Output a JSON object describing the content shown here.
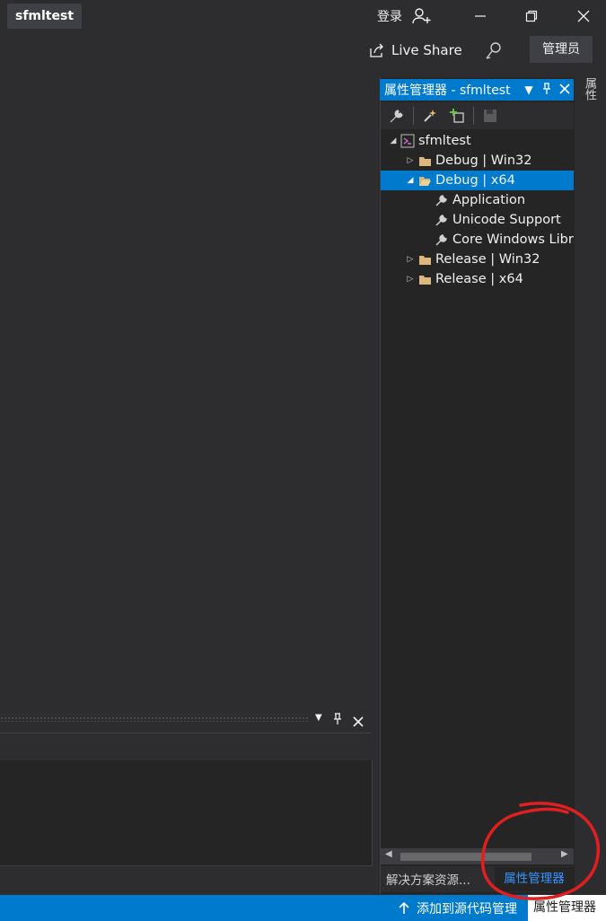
{
  "titlebar": {
    "project": "sfmltest",
    "login": "登录",
    "icons": [
      "user-add-icon",
      "minimize-icon",
      "restore-icon",
      "close-icon"
    ]
  },
  "toolbar2": {
    "live_share": "Live Share",
    "admin": "管理员"
  },
  "vertical_tab": "属性",
  "panel": {
    "title": "属性管理器 - sfmltest",
    "tree": [
      {
        "label": "sfmltest",
        "icon": "project-icon",
        "expanded": true,
        "level": 0
      },
      {
        "label": "Debug | Win32",
        "icon": "folder-icon",
        "expanded": false,
        "level": 1
      },
      {
        "label": "Debug | x64",
        "icon": "folder-open-icon",
        "expanded": true,
        "level": 1,
        "selected": true
      },
      {
        "label": "Application",
        "icon": "wrench-icon",
        "level": 2
      },
      {
        "label": "Unicode Support",
        "icon": "wrench-icon",
        "level": 2
      },
      {
        "label": "Core Windows Libraries",
        "icon": "wrench-icon",
        "level": 2
      },
      {
        "label": "Release | Win32",
        "icon": "folder-icon",
        "expanded": false,
        "level": 1
      },
      {
        "label": "Release | x64",
        "icon": "folder-icon",
        "expanded": false,
        "level": 1
      }
    ],
    "tabs": {
      "solution": "解决方案资源...",
      "property_manager": "属性管理器"
    }
  },
  "statusbar": {
    "source_control": "添加到源代码管理",
    "property_manager": "属性管理器"
  },
  "colors": {
    "accent": "#007acc",
    "background": "#2d2d30",
    "panel": "#252526",
    "annotation": "#e02020"
  }
}
